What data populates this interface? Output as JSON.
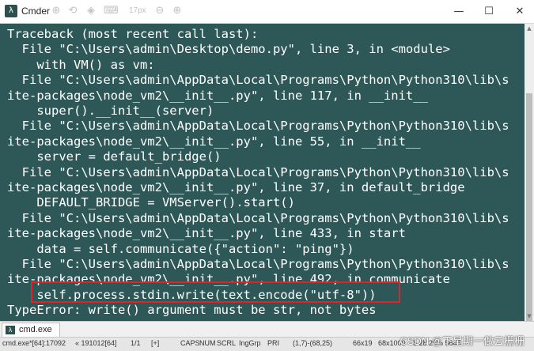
{
  "window": {
    "title": "Cmder",
    "font_size_label": "17px",
    "minimize_glyph": "—",
    "maximize_glyph": "☐",
    "close_glyph": "✕"
  },
  "terminal": {
    "lines": [
      "Traceback (most recent call last):",
      "  File \"C:\\Users\\admin\\Desktop\\demo.py\", line 3, in <module>",
      "    with VM() as vm:",
      "  File \"C:\\Users\\admin\\AppData\\Local\\Programs\\Python\\Python310\\lib\\s",
      "ite-packages\\node_vm2\\__init__.py\", line 117, in __init__",
      "    super().__init__(server)",
      "  File \"C:\\Users\\admin\\AppData\\Local\\Programs\\Python\\Python310\\lib\\s",
      "ite-packages\\node_vm2\\__init__.py\", line 55, in __init__",
      "    server = default_bridge()",
      "  File \"C:\\Users\\admin\\AppData\\Local\\Programs\\Python\\Python310\\lib\\s",
      "ite-packages\\node_vm2\\__init__.py\", line 37, in default_bridge",
      "    DEFAULT_BRIDGE = VMServer().start()",
      "  File \"C:\\Users\\admin\\AppData\\Local\\Programs\\Python\\Python310\\lib\\s",
      "ite-packages\\node_vm2\\__init__.py\", line 433, in start",
      "    data = self.communicate({\"action\": \"ping\"})",
      "  File \"C:\\Users\\admin\\AppData\\Local\\Programs\\Python\\Python310\\lib\\s",
      "ite-packages\\node_vm2\\__init__.py\", line 492, in communicate",
      "    self.process.stdin.write(text.encode(\"utf-8\"))",
      "TypeError: write() argument must be str, not bytes"
    ],
    "background": "#2e5757",
    "highlight_color": "#d9262b"
  },
  "tabs": [
    {
      "label": "cmd.exe"
    }
  ],
  "status": {
    "process": "cmd.exe*[64]:17092",
    "buffer": "« 191012[64]",
    "pages": "1/1",
    "plus": "[+]",
    "caps": "CAPS",
    "num": "NUM",
    "scrl": "SCRL",
    "ime": "IngGrp",
    "pri": "PRI",
    "cursor": "(1,7)-(68,25)",
    "size": "66x19",
    "buffer_size": "68x1000",
    "misc": "5 28 25% 5648"
  },
  "watermark": "CSDN @下星期一做云栅栅"
}
